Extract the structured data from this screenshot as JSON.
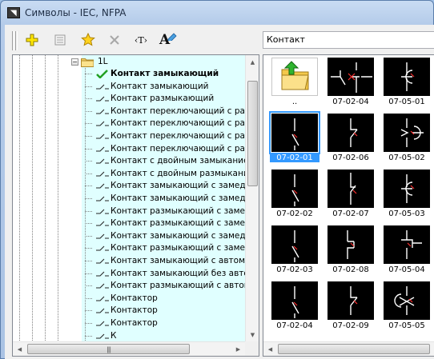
{
  "window": {
    "title": "Символы - IEC, NFPA"
  },
  "toolbar": {
    "buttons": [
      {
        "name": "add-button",
        "icon": "plus-icon"
      },
      {
        "name": "properties-button",
        "icon": "properties-icon"
      },
      {
        "name": "favorites-button",
        "icon": "star-icon"
      },
      {
        "name": "delete-button",
        "icon": "x-icon"
      },
      {
        "name": "text-button",
        "icon": "text-tag-icon",
        "label": "‹T›"
      },
      {
        "name": "rename-button",
        "icon": "font-edit-icon",
        "label": "A"
      }
    ]
  },
  "search": {
    "value": "Контакт"
  },
  "tree": {
    "folder": {
      "label": "1L",
      "expander": "−"
    },
    "items": [
      {
        "label": "Контакт замыкающий",
        "bold": true,
        "checked": true
      },
      {
        "label": "Контакт замыкающий"
      },
      {
        "label": "Контакт размыкающий"
      },
      {
        "label": "Контакт переключающий с размыканием"
      },
      {
        "label": "Контакт переключающий с размыканием"
      },
      {
        "label": "Контакт переключающий с размыканием"
      },
      {
        "label": "Контакт переключающий с размыканием"
      },
      {
        "label": "Контакт с двойным замыканием"
      },
      {
        "label": "Контакт с двойным размыканием"
      },
      {
        "label": "Контакт замыкающий с замедлением"
      },
      {
        "label": "Контакт замыкающий с замедлением"
      },
      {
        "label": "Контакт размыкающий с замедлением"
      },
      {
        "label": "Контакт размыкающий с замедлением"
      },
      {
        "label": "Контакт замыкающий с замедлением"
      },
      {
        "label": "Контакт размыкающий с замедлением"
      },
      {
        "label": "Контакт замыкающий с автоматическим"
      },
      {
        "label": "Контакт замыкающий без автоматического"
      },
      {
        "label": "Контакт размыкающий с автоматическим"
      },
      {
        "label": "Контактор"
      },
      {
        "label": "Контактор"
      },
      {
        "label": "Контактор"
      },
      {
        "label": "К"
      }
    ],
    "hscroll_grip": "|||"
  },
  "gallery": {
    "cells": [
      {
        "caption": "..",
        "kind": "folder"
      },
      {
        "caption": "07-02-04",
        "kind": "switch-no"
      },
      {
        "caption": "07-05-01",
        "kind": "switch-arc"
      },
      {
        "caption": "07-02-01",
        "kind": "switch-slant",
        "selected": true
      },
      {
        "caption": "07-02-06",
        "kind": "switch-nc"
      },
      {
        "caption": "07-05-02",
        "kind": "switch-arc-open"
      },
      {
        "caption": "07-02-02",
        "kind": "switch-slant"
      },
      {
        "caption": "07-02-07",
        "kind": "switch-nc-tall"
      },
      {
        "caption": "07-05-03",
        "kind": "switch-arc"
      },
      {
        "caption": "07-02-03",
        "kind": "switch-slant"
      },
      {
        "caption": "07-02-08",
        "kind": "switch-nc-wide"
      },
      {
        "caption": "07-05-04",
        "kind": "switch-box"
      },
      {
        "caption": "07-02-04",
        "kind": "switch-slant"
      },
      {
        "caption": "07-02-09",
        "kind": "switch-nc"
      },
      {
        "caption": "07-05-05",
        "kind": "switch-cross"
      }
    ]
  },
  "colors": {
    "tree_bg": "#e0ffff",
    "selection": "#3399ff",
    "symbol_line": "#ffffff",
    "symbol_accent": "#ff3030",
    "check": "#22a022"
  }
}
